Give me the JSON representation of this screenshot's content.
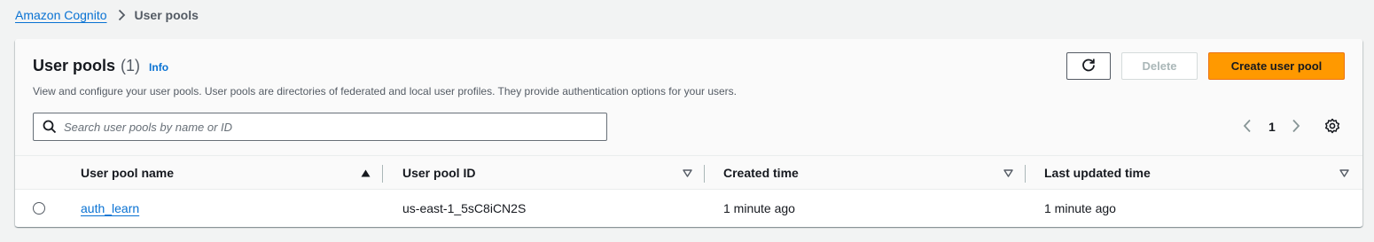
{
  "breadcrumb": {
    "parent": "Amazon Cognito",
    "current": "User pools"
  },
  "panel": {
    "title": "User pools",
    "count": "(1)",
    "info": "Info",
    "description": "View and configure your user pools. User pools are directories of federated and local user profiles. They provide authentication options for your users."
  },
  "actions": {
    "refresh_icon": "refresh-icon",
    "delete_label": "Delete",
    "create_label": "Create user pool",
    "accent_color": "#ff9900"
  },
  "search": {
    "placeholder": "Search user pools by name or ID",
    "value": ""
  },
  "pagination": {
    "current_page": "1"
  },
  "table": {
    "columns": [
      "User pool name",
      "User pool ID",
      "Created time",
      "Last updated time"
    ],
    "sorted_column": "User pool name",
    "rows": [
      {
        "name": "auth_learn",
        "id": "us-east-1_5sC8iCN2S",
        "created": "1 minute ago",
        "updated": "1 minute ago"
      }
    ]
  }
}
